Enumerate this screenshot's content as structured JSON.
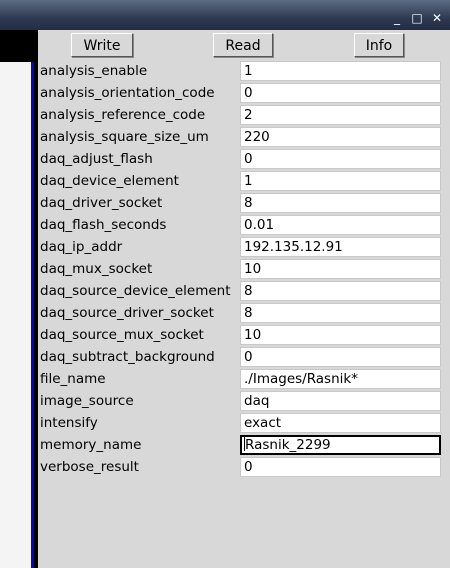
{
  "window": {
    "controls": [
      "_",
      "□",
      "✕"
    ]
  },
  "toolbar": {
    "write_label": "Write",
    "read_label": "Read",
    "info_label": "Info"
  },
  "settings": [
    {
      "label": "analysis_enable",
      "value": "1"
    },
    {
      "label": "analysis_orientation_code",
      "value": "0"
    },
    {
      "label": "analysis_reference_code",
      "value": "2"
    },
    {
      "label": "analysis_square_size_um",
      "value": "220"
    },
    {
      "label": "daq_adjust_flash",
      "value": "0"
    },
    {
      "label": "daq_device_element",
      "value": "1"
    },
    {
      "label": "daq_driver_socket",
      "value": "8"
    },
    {
      "label": "daq_flash_seconds",
      "value": "0.01"
    },
    {
      "label": "daq_ip_addr",
      "value": "192.135.12.91"
    },
    {
      "label": "daq_mux_socket",
      "value": "10"
    },
    {
      "label": "daq_source_device_element",
      "value": "8"
    },
    {
      "label": "daq_source_driver_socket",
      "value": "8"
    },
    {
      "label": "daq_source_mux_socket",
      "value": "10"
    },
    {
      "label": "daq_subtract_background",
      "value": "0"
    },
    {
      "label": "file_name",
      "value": "./Images/Rasnik*"
    },
    {
      "label": "image_source",
      "value": "daq"
    },
    {
      "label": "intensify",
      "value": "exact"
    },
    {
      "label": "memory_name",
      "value": "Rasnik_2299"
    },
    {
      "label": "verbose_result",
      "value": "0"
    }
  ],
  "focused_field": "memory_name"
}
